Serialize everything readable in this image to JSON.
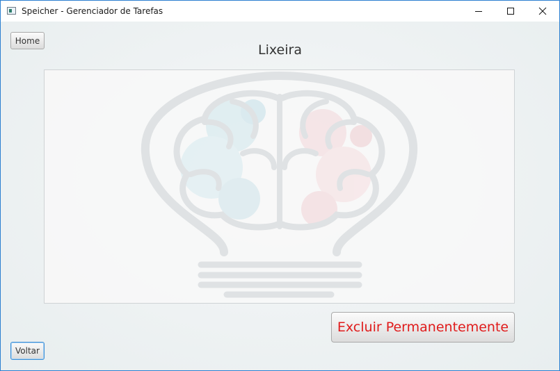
{
  "window": {
    "title": "Speicher - Gerenciador de Tarefas",
    "controls": [
      "minimize-icon",
      "maximize-icon",
      "close-icon"
    ]
  },
  "toolbar": {
    "home_label": "Home"
  },
  "page": {
    "title": "Lixeira"
  },
  "actions": {
    "delete_permanently_label": "Excluir Permanentemente",
    "back_label": "Voltar"
  },
  "colors": {
    "accent": "#2b7fd0",
    "danger_text": "#e01b1b",
    "background": "#eef2f3"
  },
  "watermark": {
    "icon": "lightbulb-brain-icon"
  }
}
